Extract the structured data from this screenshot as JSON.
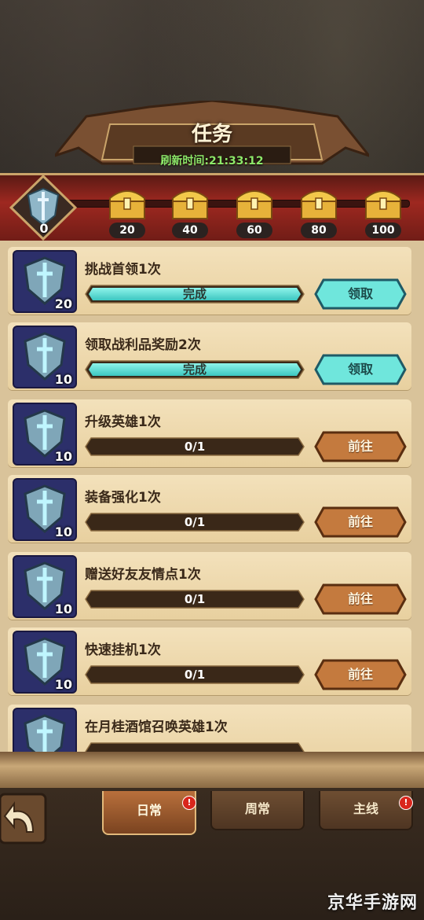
{
  "header": {
    "title": "任务",
    "refresh_text": "刷新时间:21:33:12"
  },
  "progress": {
    "points": "0",
    "chests": [
      "20",
      "40",
      "60",
      "80",
      "100"
    ]
  },
  "tasks": [
    {
      "title": "挑战首领1次",
      "reward": "20",
      "progress_text": "完成",
      "progress_ratio": 1,
      "button": "领取",
      "state": "claim"
    },
    {
      "title": "领取战利品奖励2次",
      "reward": "10",
      "progress_text": "完成",
      "progress_ratio": 1,
      "button": "领取",
      "state": "claim"
    },
    {
      "title": "升级英雄1次",
      "reward": "10",
      "progress_text": "0/1",
      "progress_ratio": 0,
      "button": "前往",
      "state": "go"
    },
    {
      "title": "装备强化1次",
      "reward": "10",
      "progress_text": "0/1",
      "progress_ratio": 0,
      "button": "前往",
      "state": "go"
    },
    {
      "title": "赠送好友友情点1次",
      "reward": "10",
      "progress_text": "0/1",
      "progress_ratio": 0,
      "button": "前往",
      "state": "go"
    },
    {
      "title": "快速挂机1次",
      "reward": "10",
      "progress_text": "0/1",
      "progress_ratio": 0,
      "button": "前往",
      "state": "go"
    },
    {
      "title": "在月桂酒馆召唤英雄1次",
      "reward": "",
      "progress_text": "",
      "progress_ratio": 0,
      "button": "",
      "state": "go"
    }
  ],
  "tabs": [
    {
      "label": "日常",
      "active": true,
      "alert": "!"
    },
    {
      "label": "周常",
      "active": false,
      "alert": ""
    },
    {
      "label": "主线",
      "active": false,
      "alert": "!"
    }
  ],
  "watermark": "京华手游网",
  "colors": {
    "claim_bar": "#5ee0d6",
    "go_button": "#c0763a",
    "alert": "#d9261c"
  }
}
